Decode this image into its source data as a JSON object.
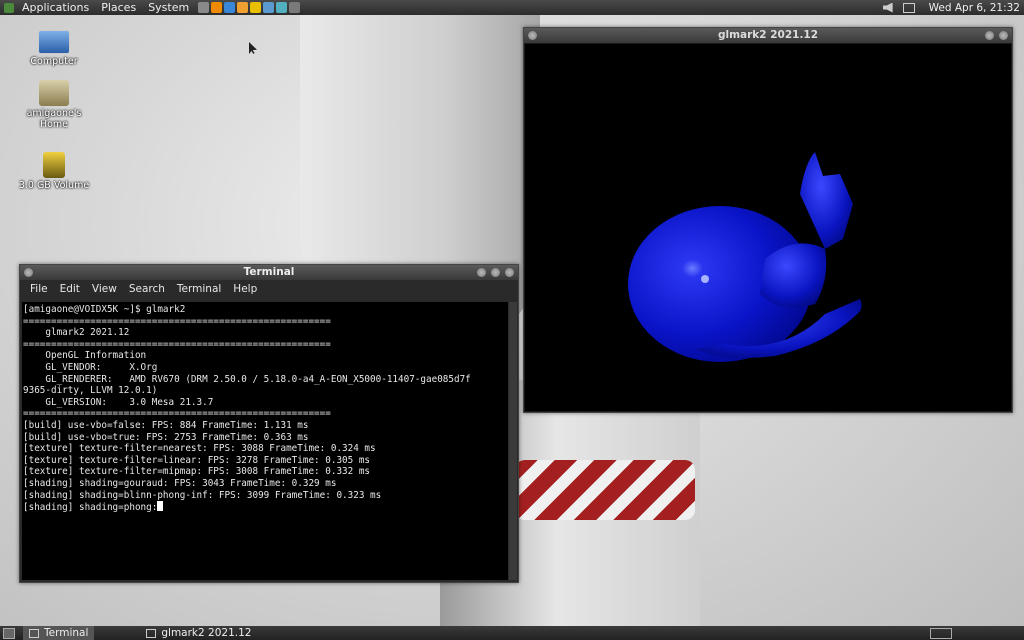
{
  "top_panel": {
    "menus": [
      "Applications",
      "Places",
      "System"
    ],
    "launchers": [
      {
        "icon": "terminal-launcher-icon",
        "color": "#8a8a8a"
      },
      {
        "icon": "vlc-launcher-icon",
        "color": "#f08a00"
      },
      {
        "icon": "browser-launcher-icon",
        "color": "#3a86d8"
      },
      {
        "icon": "firefox-launcher-icon",
        "color": "#f0a030"
      },
      {
        "icon": "media-launcher-icon",
        "color": "#e8c000"
      },
      {
        "icon": "tool-launcher-icon",
        "color": "#5a9ad0"
      },
      {
        "icon": "web-launcher-icon",
        "color": "#50b0c0"
      },
      {
        "icon": "image-launcher-icon",
        "color": "#7a7a7a"
      }
    ],
    "clock": "Wed Apr  6, 21:32"
  },
  "desktop_icons": [
    {
      "label": "Computer",
      "icon": "computer-icon"
    },
    {
      "label": "amigaone's Home",
      "icon": "home-folder-icon"
    },
    {
      "label": "3.0 GB Volume",
      "icon": "drive-icon"
    }
  ],
  "terminal": {
    "title": "Terminal",
    "menu": [
      "File",
      "Edit",
      "View",
      "Search",
      "Terminal",
      "Help"
    ],
    "lines": [
      "[amigaone@VOIDX5K ~]$ glmark2",
      "=======================================================",
      "    glmark2 2021.12",
      "=======================================================",
      "    OpenGL Information",
      "    GL_VENDOR:     X.Org",
      "    GL_RENDERER:   AMD RV670 (DRM 2.50.0 / 5.18.0-a4_A-EON_X5000-11407-gae085d7f",
      "9365-dirty, LLVM 12.0.1)",
      "    GL_VERSION:    3.0 Mesa 21.3.7",
      "=======================================================",
      "[build] use-vbo=false: FPS: 884 FrameTime: 1.131 ms",
      "[build] use-vbo=true: FPS: 2753 FrameTime: 0.363 ms",
      "[texture] texture-filter=nearest: FPS: 3088 FrameTime: 0.324 ms",
      "[texture] texture-filter=linear: FPS: 3278 FrameTime: 0.305 ms",
      "[texture] texture-filter=mipmap: FPS: 3008 FrameTime: 0.332 ms",
      "[shading] shading=gouraud: FPS: 3043 FrameTime: 0.329 ms",
      "[shading] shading=blinn-phong-inf: FPS: 3099 FrameTime: 0.323 ms"
    ],
    "prompt_line": "[shading] shading=phong:"
  },
  "glmark": {
    "title": "glmark2 2021.12",
    "model_color": "#0a14d8"
  },
  "taskbar": [
    {
      "label": "Terminal",
      "icon": "terminal-task-icon",
      "active": true
    },
    {
      "label": "glmark2 2021.12",
      "icon": "window-task-icon",
      "active": false
    }
  ]
}
